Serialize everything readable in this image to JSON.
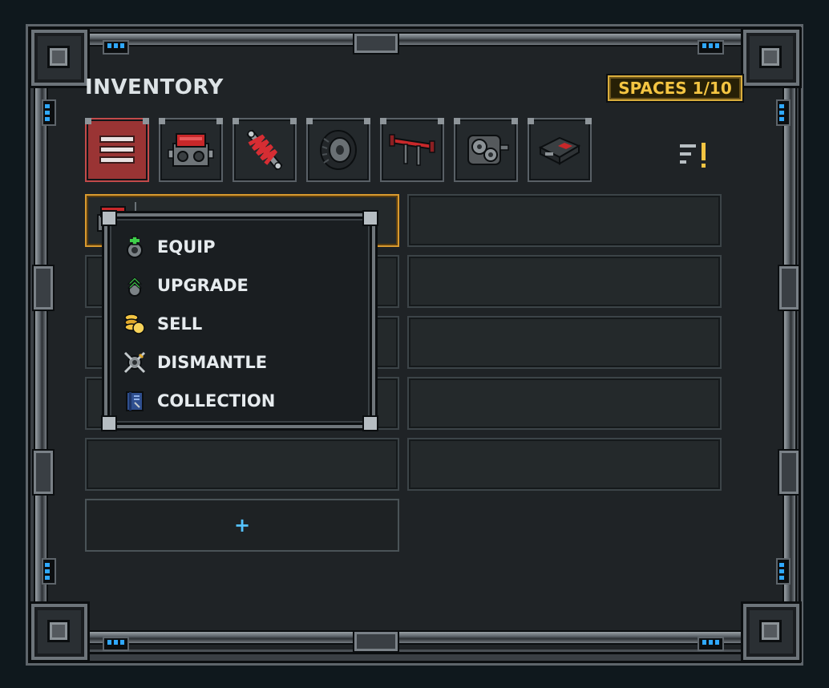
{
  "header": {
    "title": "INVENTORY",
    "spaces_label": "SPACES 1/10"
  },
  "tabs": [
    {
      "id": "all",
      "icon": "list-icon",
      "active": true
    },
    {
      "id": "engine",
      "icon": "engine-icon",
      "active": false
    },
    {
      "id": "suspension",
      "icon": "shock-absorber-icon",
      "active": false
    },
    {
      "id": "tires",
      "icon": "tire-icon",
      "active": false
    },
    {
      "id": "spoiler",
      "icon": "spoiler-icon",
      "active": false
    },
    {
      "id": "transmission",
      "icon": "gearbox-icon",
      "active": false
    },
    {
      "id": "electronics",
      "icon": "ecu-icon",
      "active": false
    }
  ],
  "sort": {
    "icon": "sort-icon"
  },
  "add_slot": {
    "label": "+"
  },
  "context_menu": {
    "items": [
      {
        "label": "EQUIP",
        "icon": "equip-icon"
      },
      {
        "label": "UPGRADE",
        "icon": "upgrade-icon"
      },
      {
        "label": "SELL",
        "icon": "coins-icon"
      },
      {
        "label": "DISMANTLE",
        "icon": "dismantle-icon"
      },
      {
        "label": "COLLECTION",
        "icon": "collection-icon"
      }
    ]
  },
  "colors": {
    "accent_gold": "#f4c542",
    "active_tab": "#9a3434",
    "add_plus": "#55c3ff",
    "selected_border": "#d99a2f"
  }
}
